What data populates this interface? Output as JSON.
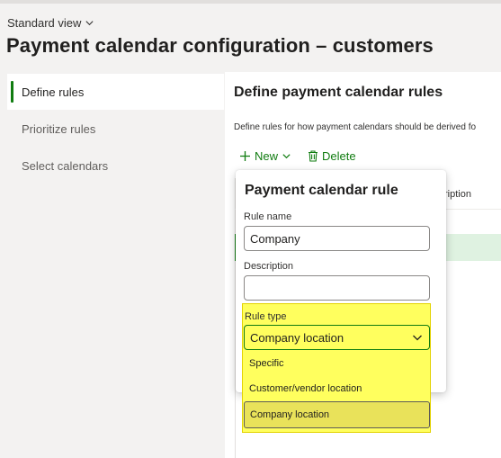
{
  "header": {
    "view_label": "Standard view",
    "page_title": "Payment calendar configuration – customers"
  },
  "sidebar": {
    "items": [
      {
        "label": "Define rules"
      },
      {
        "label": "Prioritize rules"
      },
      {
        "label": "Select calendars"
      }
    ]
  },
  "main": {
    "title": "Define payment calendar rules",
    "description": "Define rules for how payment calendars should be derived fo",
    "toolbar": {
      "new_label": "New",
      "delete_label": "Delete"
    },
    "grid": {
      "partial_column_header": "ription"
    }
  },
  "popup": {
    "title": "Payment calendar rule",
    "rule_name_label": "Rule name",
    "rule_name_value": "Company",
    "description_label": "Description",
    "description_value": "",
    "rule_type_label": "Rule type",
    "rule_type_value": "Company location",
    "rule_type_options": [
      "Specific",
      "Customer/vendor location",
      "Company location"
    ]
  },
  "colors": {
    "accent": "#107c10",
    "highlight": "#ffff5e",
    "selected_row": "#dff2e1"
  },
  "icons": {
    "view_chevron": "chevron-down-icon",
    "new": "plus-icon",
    "new_chevron": "chevron-down-icon",
    "delete": "trash-icon",
    "select_chevron": "chevron-down-icon"
  }
}
